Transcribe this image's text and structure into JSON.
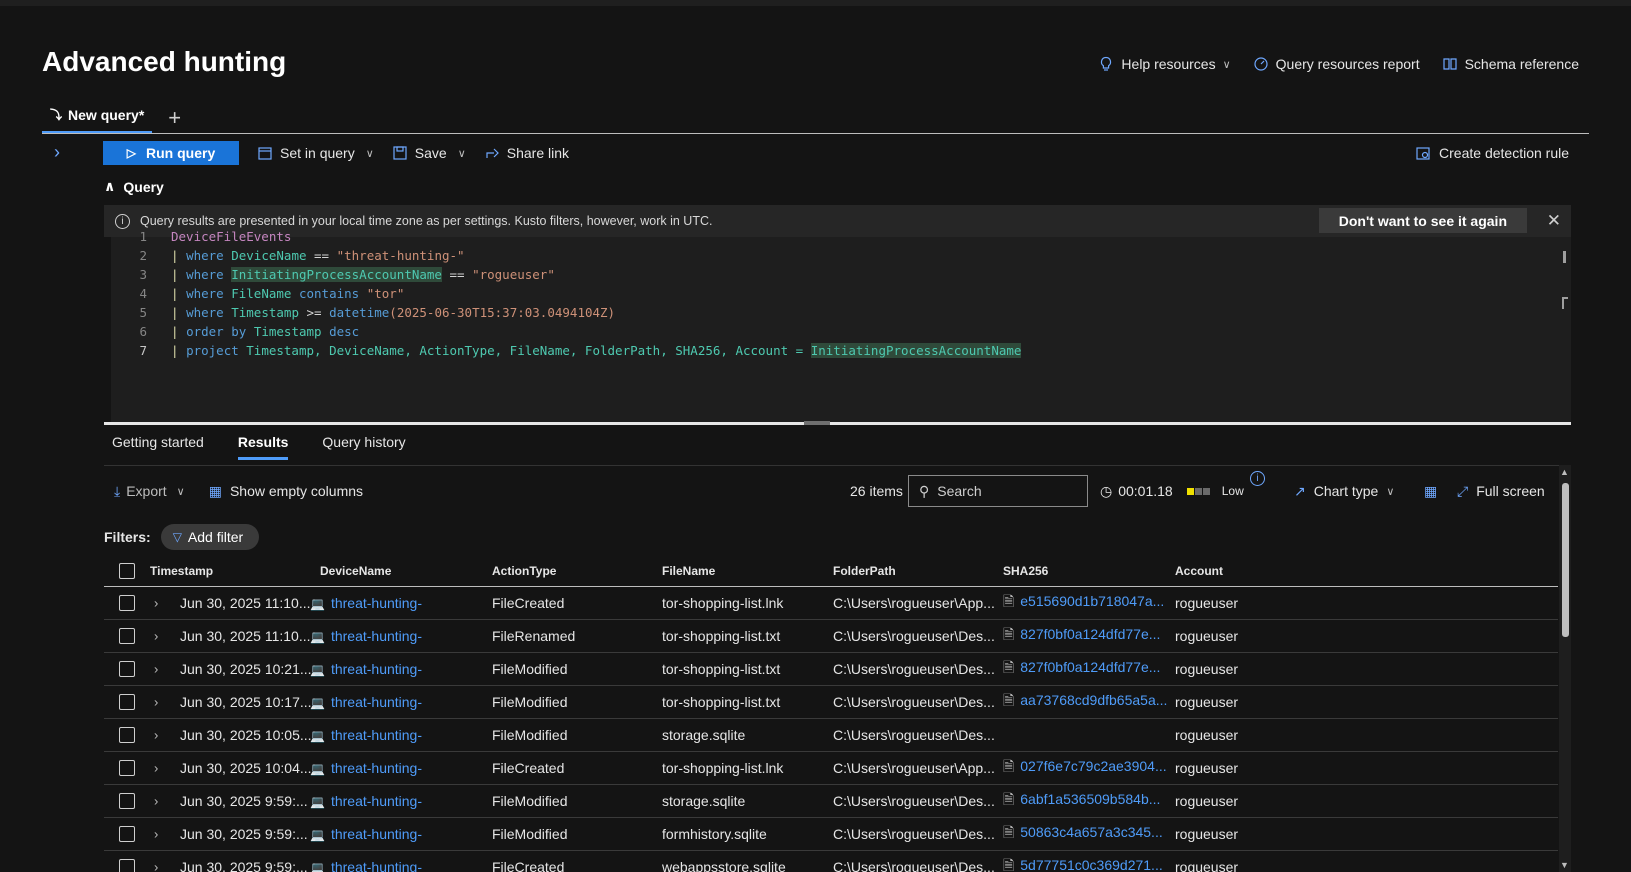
{
  "page": {
    "title": "Advanced hunting",
    "top_links": {
      "help": "Help resources",
      "report": "Query resources report",
      "schema": "Schema reference"
    }
  },
  "tabs": {
    "active": "New query*"
  },
  "toolbar": {
    "run": "Run query",
    "set_in_query": "Set in query",
    "save": "Save",
    "share": "Share link",
    "create_rule": "Create detection rule"
  },
  "query_section": {
    "label": "Query",
    "info": "Query results are presented in your local time zone as per settings. Kusto filters, however, work in UTC.",
    "dismiss": "Don't want to see it again"
  },
  "code": {
    "line_numbers": [
      "1",
      "2",
      "3",
      "4",
      "5",
      "6",
      "7"
    ],
    "l1": {
      "table": "DeviceFileEvents"
    },
    "l2": {
      "bar": "|",
      "kw": "where",
      "col": "DeviceName",
      "op": " == ",
      "str": "\"threat-hunting-\""
    },
    "l3": {
      "bar": "|",
      "kw": "where",
      "col": "InitiatingProcessAccountName",
      "op": " == ",
      "str": "\"rogueuser\""
    },
    "l4": {
      "bar": "|",
      "kw": "where",
      "col": "FileName",
      "op": "contains",
      "str": "\"tor\""
    },
    "l5": {
      "bar": "|",
      "kw": "where",
      "col": "Timestamp",
      "op": " >= ",
      "fn": "datetime",
      "arg": "(2025-06-30T15:37:03.0494104Z)"
    },
    "l6": {
      "bar": "|",
      "kw": "order",
      "kw2": "by",
      "col": "Timestamp",
      "kw3": "desc"
    },
    "l7": {
      "bar": "|",
      "kw": "project",
      "cols": "Timestamp, DeviceName, ActionType, FileName, FolderPath, SHA256, Account = ",
      "hl": "InitiatingProcessAccountName"
    }
  },
  "result_tabs": {
    "getting_started": "Getting started",
    "results": "Results",
    "history": "Query history"
  },
  "results_toolbar": {
    "export": "Export",
    "show_empty": "Show empty columns",
    "items": "26 items",
    "search_placeholder": "Search",
    "elapsed": "00:01.18",
    "severity": "Low",
    "chart_type": "Chart type",
    "full_screen": "Full screen"
  },
  "filters": {
    "label": "Filters:",
    "add": "Add filter"
  },
  "table": {
    "headers": {
      "timestamp": "Timestamp",
      "device": "DeviceName",
      "action": "ActionType",
      "file": "FileName",
      "folder": "FolderPath",
      "sha": "SHA256",
      "account": "Account"
    },
    "rows": [
      {
        "ts": "Jun 30, 2025 11:10...",
        "device": "threat-hunting-",
        "action": "FileCreated",
        "file": "tor-shopping-list.lnk",
        "folder": "C:\\Users\\rogueuser\\App...",
        "sha": "e515690d1b718047a...",
        "account": "rogueuser"
      },
      {
        "ts": "Jun 30, 2025 11:10...",
        "device": "threat-hunting-",
        "action": "FileRenamed",
        "file": "tor-shopping-list.txt",
        "folder": "C:\\Users\\rogueuser\\Des...",
        "sha": "827f0bf0a124dfd77e...",
        "account": "rogueuser"
      },
      {
        "ts": "Jun 30, 2025 10:21...",
        "device": "threat-hunting-",
        "action": "FileModified",
        "file": "tor-shopping-list.txt",
        "folder": "C:\\Users\\rogueuser\\Des...",
        "sha": "827f0bf0a124dfd77e...",
        "account": "rogueuser"
      },
      {
        "ts": "Jun 30, 2025 10:17...",
        "device": "threat-hunting-",
        "action": "FileModified",
        "file": "tor-shopping-list.txt",
        "folder": "C:\\Users\\rogueuser\\Des...",
        "sha": "aa73768cd9dfb65a5a...",
        "account": "rogueuser"
      },
      {
        "ts": "Jun 30, 2025 10:05...",
        "device": "threat-hunting-",
        "action": "FileModified",
        "file": "storage.sqlite",
        "folder": "C:\\Users\\rogueuser\\Des...",
        "sha": "",
        "account": "rogueuser"
      },
      {
        "ts": "Jun 30, 2025 10:04...",
        "device": "threat-hunting-",
        "action": "FileCreated",
        "file": "tor-shopping-list.lnk",
        "folder": "C:\\Users\\rogueuser\\App...",
        "sha": "027f6e7c79c2ae3904...",
        "account": "rogueuser"
      },
      {
        "ts": "Jun 30, 2025 9:59:...",
        "device": "threat-hunting-",
        "action": "FileModified",
        "file": "storage.sqlite",
        "folder": "C:\\Users\\rogueuser\\Des...",
        "sha": "6abf1a536509b584b...",
        "account": "rogueuser"
      },
      {
        "ts": "Jun 30, 2025 9:59:...",
        "device": "threat-hunting-",
        "action": "FileModified",
        "file": "formhistory.sqlite",
        "folder": "C:\\Users\\rogueuser\\Des...",
        "sha": "50863c4a657a3c345...",
        "account": "rogueuser"
      },
      {
        "ts": "Jun 30, 2025 9:59:...",
        "device": "threat-hunting-",
        "action": "FileCreated",
        "file": "webappsstore.sqlite",
        "folder": "C:\\Users\\rogueuser\\Des...",
        "sha": "5d77751c0c369d271...",
        "account": "rogueuser"
      }
    ]
  },
  "colors": {
    "accent": "#1a74d8",
    "link": "#4f9cf9",
    "background": "#141414"
  }
}
